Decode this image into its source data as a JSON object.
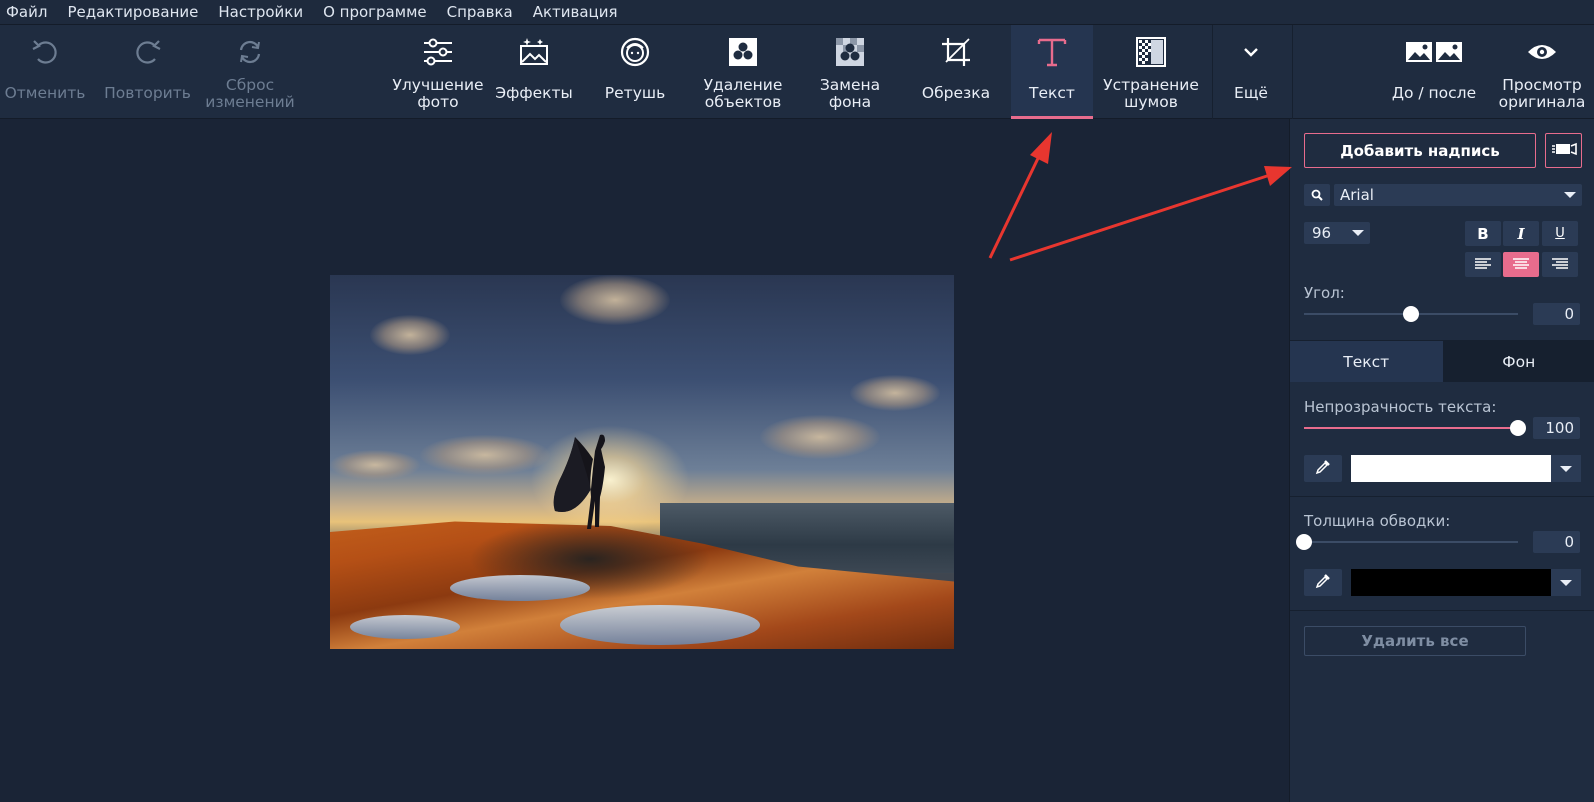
{
  "menu": [
    "Файл",
    "Редактирование",
    "Настройки",
    "О программе",
    "Справка",
    "Активация"
  ],
  "toolbar": {
    "undo": "Отменить",
    "redo": "Повторить",
    "reset": "Сброс\nизменений",
    "enhance": "Улучшение\nфото",
    "effects": "Эффекты",
    "retouch": "Ретушь",
    "remove_objects": "Удаление\nобъектов",
    "replace_bg": "Замена\nфона",
    "crop": "Обрезка",
    "text": "Текст",
    "denoise": "Устранение\nшумов",
    "more": "Ещё",
    "before_after": "До / после",
    "view_original": "Просмотр\nоригинала",
    "active_tab": "text"
  },
  "panel": {
    "add_caption": "Добавить надпись",
    "font": "Arial",
    "size": "96",
    "bold": "B",
    "italic": "I",
    "underline": "U",
    "alignment": "center",
    "angle_label": "Угол:",
    "angle_value": "0",
    "angle_level": 0.5,
    "tab_text": "Текст",
    "tab_bg": "Фон",
    "opacity_label": "Непрозрачность текста:",
    "opacity_value": "100",
    "text_color": "#ffffff",
    "stroke_label": "Толщина обводки:",
    "stroke_value": "0",
    "stroke_color": "#000000",
    "delete_all": "Удалить все"
  },
  "colors": {
    "accent": "#e86c8d",
    "arrow": "#e8362f"
  }
}
